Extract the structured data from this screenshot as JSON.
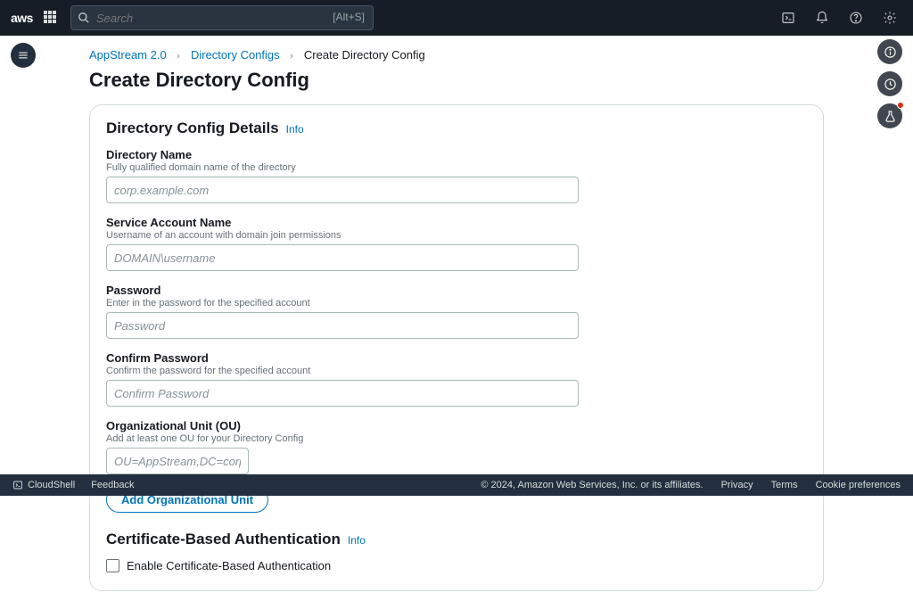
{
  "topnav": {
    "logo": "aws",
    "search_placeholder": "Search",
    "search_hint": "[Alt+S]"
  },
  "breadcrumbs": {
    "level1": "AppStream 2.0",
    "level2": "Directory Configs",
    "level3": "Create Directory Config"
  },
  "page": {
    "title": "Create Directory Config"
  },
  "section1": {
    "heading": "Directory Config Details",
    "info": "Info"
  },
  "fields": {
    "dirname": {
      "label": "Directory Name",
      "desc": "Fully qualified domain name of the directory",
      "placeholder": "corp.example.com",
      "value": ""
    },
    "svcacct": {
      "label": "Service Account Name",
      "desc": "Username of an account with domain join permissions",
      "placeholder": "DOMAIN\\username",
      "value": ""
    },
    "password": {
      "label": "Password",
      "desc": "Enter in the password for the specified account",
      "placeholder": "Password",
      "value": ""
    },
    "confirm": {
      "label": "Confirm Password",
      "desc": "Confirm the password for the specified account",
      "placeholder": "Confirm Password",
      "value": ""
    },
    "ou": {
      "label": "Organizational Unit (OU)",
      "desc": "Add at least one OU for your Directory Config",
      "placeholder": "OU=AppStream,DC=corp,DC=example,DC=com",
      "value": ""
    }
  },
  "buttons": {
    "add_ou": "Add Organizational Unit"
  },
  "section2": {
    "heading": "Certificate-Based Authentication",
    "info": "Info",
    "checkbox_label": "Enable Certificate-Based Authentication",
    "checked": false
  },
  "footer": {
    "cloudshell": "CloudShell",
    "feedback": "Feedback",
    "copyright": "© 2024, Amazon Web Services, Inc. or its affiliates.",
    "privacy": "Privacy",
    "terms": "Terms",
    "cookies": "Cookie preferences"
  }
}
